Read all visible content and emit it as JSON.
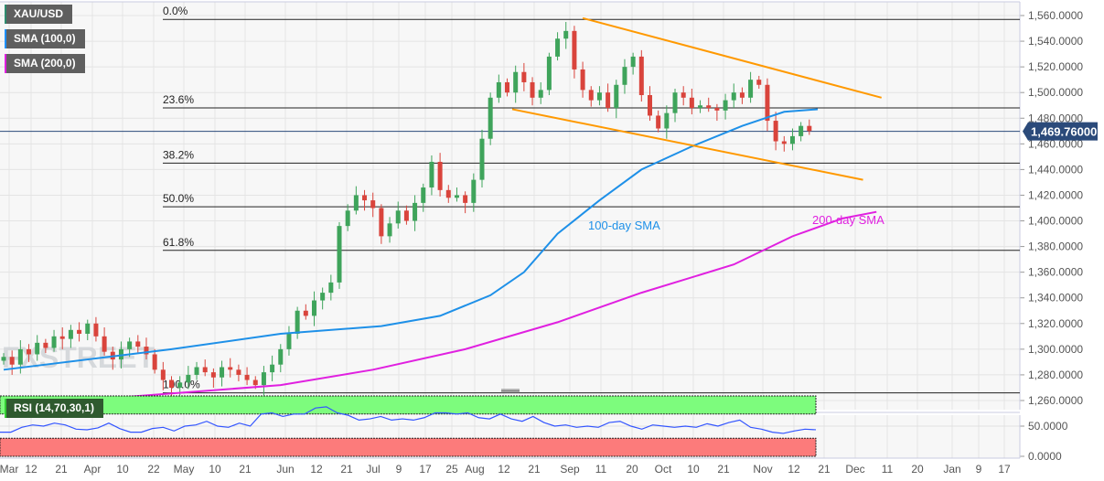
{
  "legend": [
    {
      "label": "XAU/USD",
      "color": "#2e8b6e"
    },
    {
      "label": "SMA (100,0)",
      "color": "#1e90ff"
    },
    {
      "label": "SMA (200,0)",
      "color": "#e020e0"
    }
  ],
  "rsi_legend": "RSI (14,70,30,1)",
  "watermark": "FXSTREET",
  "chart_data": {
    "type": "candlestick",
    "title": "XAU/USD",
    "ylim": [
      1250,
      1570
    ],
    "yticks": [
      1260,
      1280,
      1300,
      1320,
      1340,
      1360,
      1380,
      1400,
      1420,
      1440,
      1460,
      1480,
      1500,
      1520,
      1540,
      1560
    ],
    "ytick_labels": [
      "1,260.0000",
      "1,280.0000",
      "1,300.0000",
      "1,320.0000",
      "1,340.0000",
      "1,360.0000",
      "1,380.0000",
      "1,400.0000",
      "1,420.0000",
      "1,440.0000",
      "1,460.0000",
      "1,480.0000",
      "1,500.0000",
      "1,520.0000",
      "1,540.0000",
      "1,560.0000"
    ],
    "xtick_labels": [
      "Mar",
      "12",
      "21",
      "Apr",
      "10",
      "22",
      "May",
      "10",
      "21",
      "Jun",
      "12",
      "21",
      "Jul",
      "9",
      "17",
      "25",
      "Aug",
      "12",
      "21",
      "Sep",
      "11",
      "20",
      "Oct",
      "10",
      "21",
      "Nov",
      "12",
      "21",
      "Dec",
      "11",
      "20",
      "Jan",
      "9",
      "17"
    ],
    "last_price": 1469.76,
    "last_price_label": "1,469.76000",
    "closes": [
      1294,
      1288,
      1300,
      1296,
      1305,
      1301,
      1310,
      1308,
      1315,
      1312,
      1320,
      1310,
      1298,
      1292,
      1300,
      1306,
      1302,
      1296,
      1284,
      1276,
      1270,
      1274,
      1280,
      1286,
      1282,
      1278,
      1286,
      1284,
      1280,
      1276,
      1272,
      1282,
      1288,
      1300,
      1312,
      1330,
      1326,
      1338,
      1344,
      1352,
      1396,
      1408,
      1420,
      1416,
      1410,
      1388,
      1398,
      1408,
      1400,
      1414,
      1426,
      1446,
      1424,
      1418,
      1420,
      1414,
      1432,
      1464,
      1496,
      1508,
      1500,
      1516,
      1508,
      1496,
      1502,
      1528,
      1542,
      1548,
      1518,
      1502,
      1494,
      1500,
      1488,
      1506,
      1520,
      1528,
      1498,
      1482,
      1472,
      1484,
      1500,
      1496,
      1488,
      1490,
      1488,
      1486,
      1494,
      1500,
      1496,
      1510,
      1506,
      1478,
      1462,
      1460,
      1466,
      1474,
      1470
    ],
    "sma100": [
      [
        0,
        1284
      ],
      [
        20,
        1300
      ],
      [
        33,
        1312
      ],
      [
        45,
        1318
      ],
      [
        52,
        1326
      ],
      [
        58,
        1342
      ],
      [
        62,
        1360
      ],
      [
        66,
        1390
      ],
      [
        71,
        1416
      ],
      [
        76,
        1440
      ],
      [
        82,
        1458
      ],
      [
        88,
        1474
      ],
      [
        93,
        1485
      ],
      [
        97,
        1487
      ]
    ],
    "sma200": [
      [
        13,
        1262
      ],
      [
        33,
        1272
      ],
      [
        44,
        1284
      ],
      [
        55,
        1300
      ],
      [
        66,
        1321
      ],
      [
        76,
        1344
      ],
      [
        87,
        1366
      ],
      [
        94,
        1388
      ],
      [
        100,
        1402
      ],
      [
        104,
        1407
      ]
    ],
    "sma100_label": "100-day SMA",
    "sma200_label": "200-day SMA",
    "channel": [
      {
        "from": [
          69,
          1558
        ],
        "to": [
          104.6,
          1496
        ]
      },
      {
        "from": [
          60.6,
          1487
        ],
        "to": [
          102.4,
          1432
        ]
      }
    ],
    "fibonacci": [
      {
        "label": "0.0%",
        "value": 1557
      },
      {
        "label": "23.6%",
        "value": 1488
      },
      {
        "label": "38.2%",
        "value": 1445
      },
      {
        "label": "50.0%",
        "value": 1411
      },
      {
        "label": "61.8%",
        "value": 1377
      },
      {
        "label": "100.0%",
        "value": 1266
      }
    ],
    "rsi": {
      "ylim": [
        0,
        100
      ],
      "overbought": 70,
      "oversold": 30,
      "yticks": [
        0,
        50
      ],
      "ytick_labels": [
        "0.0000",
        "50.0000"
      ],
      "values": [
        40,
        40,
        48,
        52,
        50,
        55,
        52,
        45,
        44,
        47,
        55,
        46,
        40,
        40,
        46,
        48,
        42,
        50,
        52,
        58,
        50,
        48,
        55,
        50,
        70,
        72,
        66,
        70,
        70,
        80,
        82,
        72,
        68,
        60,
        62,
        66,
        60,
        62,
        60,
        64,
        72,
        72,
        70,
        72,
        64,
        62,
        70,
        62,
        58,
        66,
        56,
        50,
        52,
        48,
        50,
        48,
        56,
        58,
        50,
        45,
        52,
        50,
        48,
        50,
        48,
        54,
        50,
        56,
        60,
        48,
        45,
        40,
        38,
        42,
        45,
        44
      ]
    }
  },
  "colors": {
    "up": "#3fa45b",
    "down": "#d9443c",
    "sma100": "#1e90e8",
    "sma200": "#e020e0",
    "channel": "#ff9900",
    "rsi": "#3355ff"
  }
}
